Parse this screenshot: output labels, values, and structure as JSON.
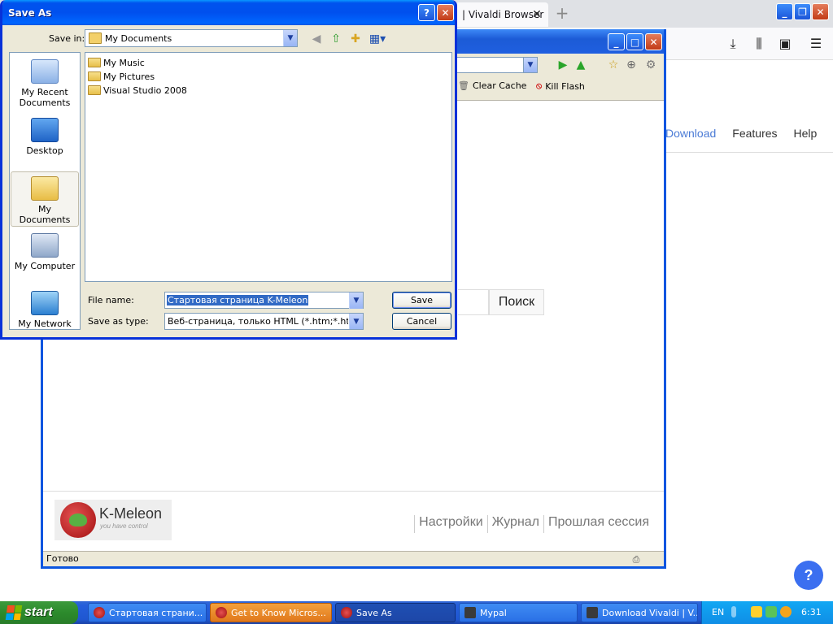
{
  "firefox": {
    "tab_title": "| Vivaldi Browser",
    "tab_close": "✕",
    "new_tab": "+",
    "toolbar_icons": [
      "download-icon",
      "library-icon",
      "sidebar-icon",
      "menu-icon"
    ],
    "page_nav": [
      "Download",
      "Features",
      "Help"
    ],
    "help_bubble": "?"
  },
  "kmeleon": {
    "toolbar": {
      "clear_cache": "Clear Cache",
      "kill_flash": "Kill Flash"
    },
    "search_button": "Поиск",
    "logo": {
      "name": "K-Meleon",
      "tagline": "you have control"
    },
    "footer_links": [
      "Настройки",
      "Журнал",
      "Прошлая сессия"
    ],
    "status_text": "Готово"
  },
  "dialog": {
    "title": "Save As",
    "help_button": "?",
    "close_button": "✕",
    "save_in_label": "Save in:",
    "save_in_value": "My Documents",
    "places": [
      {
        "label": "My Recent Documents",
        "icon": "recent-documents-icon"
      },
      {
        "label": "Desktop",
        "icon": "desktop-icon"
      },
      {
        "label": "My Documents",
        "icon": "my-documents-icon",
        "selected": true
      },
      {
        "label": "My Computer",
        "icon": "my-computer-icon"
      },
      {
        "label": "My Network",
        "icon": "my-network-icon"
      }
    ],
    "files": [
      "My Music",
      "My Pictures",
      "Visual Studio 2008"
    ],
    "file_name_label": "File name:",
    "file_name_value": "Стартовая страница K-Meleon",
    "save_as_type_label": "Save as type:",
    "save_as_type_value": "Веб-страница, только HTML (*.htm;*.html;*.xhtml)",
    "save_button": "Save",
    "cancel_button": "Cancel"
  },
  "taskbar": {
    "start_label": "start",
    "tasks": [
      {
        "label": "Стартовая страни...",
        "state": "normal"
      },
      {
        "label": "Get to Know Micros...",
        "state": "orange"
      },
      {
        "label": "Save As",
        "state": "active"
      },
      {
        "label": "Mypal",
        "state": "normal"
      },
      {
        "label": "Download Vivaldi | V...",
        "state": "normal"
      }
    ],
    "language": "EN",
    "clock": "6:31"
  },
  "colors": {
    "xp_blue": "#0a55e0",
    "dialog_face": "#ece9d8",
    "selection": "#316ac5",
    "ff_link": "#4b7bd6",
    "help_bubble": "#3b6ff0"
  }
}
